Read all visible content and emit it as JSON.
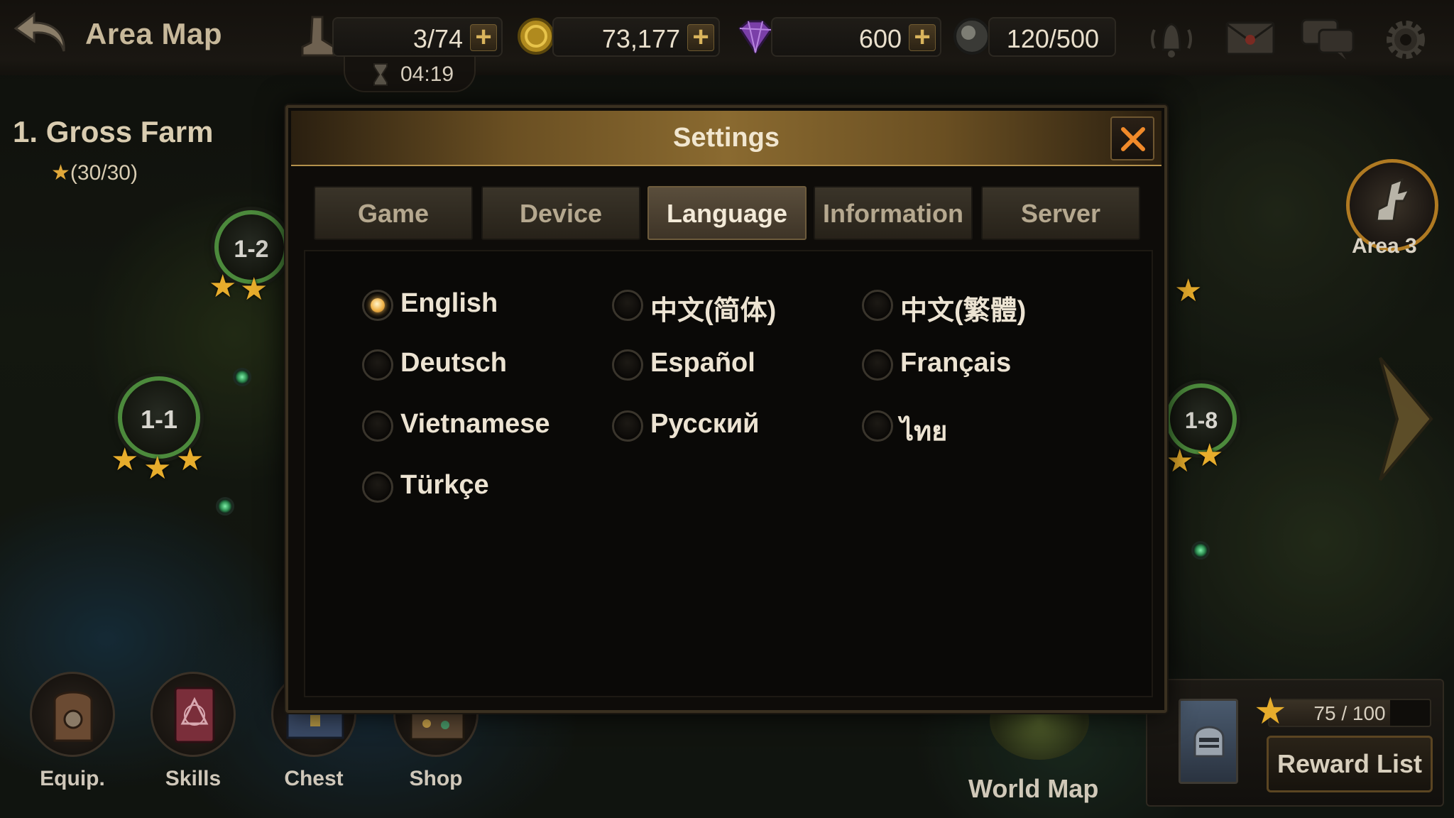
{
  "topbar": {
    "title": "Area Map",
    "stamina": "3/74",
    "gold": "73,177",
    "gems": "600",
    "capacity": "120/500",
    "timer": "04:19",
    "icons": [
      "back-arrow-icon",
      "boot-icon",
      "gold-coin-icon",
      "gem-icon",
      "orb-icon",
      "hourglass-icon",
      "bell-icon",
      "mail-icon",
      "chat-icon",
      "gear-icon"
    ]
  },
  "area": {
    "name": "1. Gross Farm",
    "stars": "(30/30)"
  },
  "stages": [
    {
      "label": "1-2",
      "stars": 2
    },
    {
      "label": "1-1",
      "stars": 3
    },
    {
      "label": "1-8",
      "stars": 2
    }
  ],
  "right": {
    "area_button_label": "Area 3",
    "reward_progress": "75 / 100",
    "reward_fraction": 0.75,
    "reward_button": "Reward List",
    "world_map_label": "World Map"
  },
  "bottom_menu": [
    {
      "label": "Equip.",
      "icon": "backpack-icon"
    },
    {
      "label": "Skills",
      "icon": "spellbook-icon"
    },
    {
      "label": "Chest",
      "icon": "chest-icon"
    },
    {
      "label": "Shop",
      "icon": "shop-icon"
    }
  ],
  "dialog": {
    "title": "Settings",
    "tabs": [
      "Game",
      "Device",
      "Language",
      "Information",
      "Server"
    ],
    "active_tab": "Language",
    "languages": [
      "English",
      "中文(简体)",
      "中文(繁體)",
      "Deutsch",
      "Español",
      "Français",
      "Vietnamese",
      "Русский",
      "ไทย",
      "Türkçe"
    ],
    "selected_language": "English"
  },
  "colors": {
    "accent_gold": "#e7ad2c",
    "stage_ring": "#4c8a3c",
    "radio_selected": "#f0b34a"
  }
}
